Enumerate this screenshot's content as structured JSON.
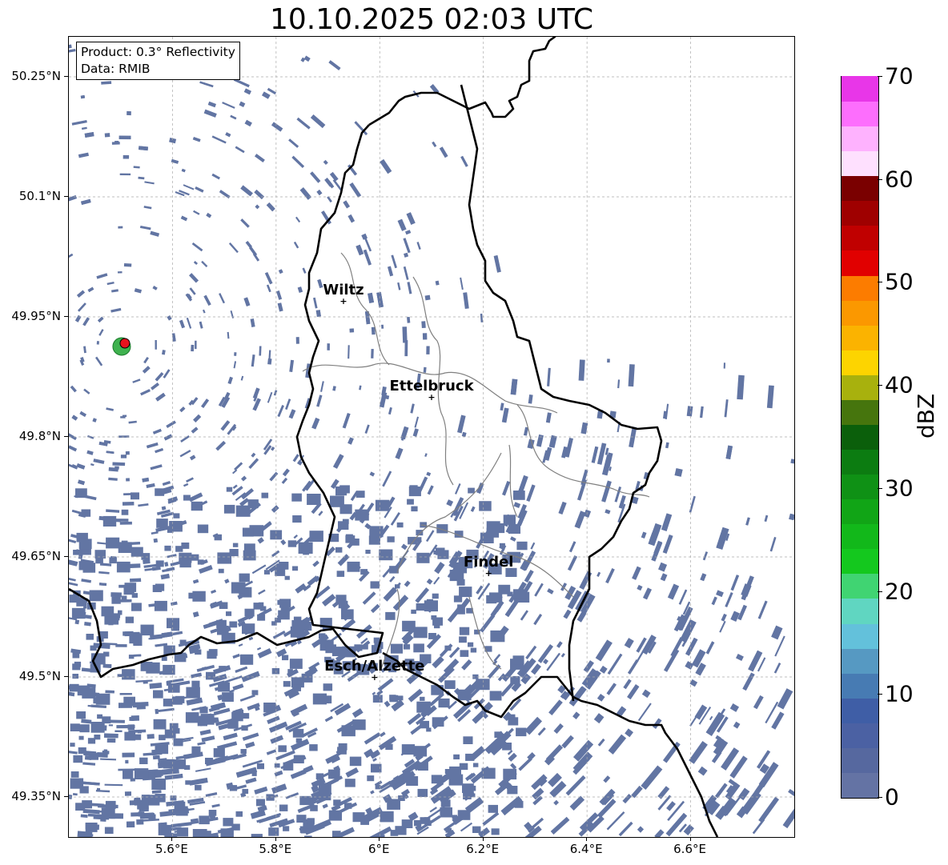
{
  "title": "10.10.2025 02:03 UTC",
  "info": {
    "product": "Product: 0.3° Reflectivity",
    "data_source": "Data: RMIB"
  },
  "axes": {
    "lat_labels": [
      "50.25°N",
      "50.1°N",
      "49.95°N",
      "49.8°N",
      "49.65°N",
      "49.5°N",
      "49.35°N"
    ],
    "lon_labels": [
      "5.6°E",
      "5.8°E",
      "6°E",
      "6.2°E",
      "6.4°E",
      "6.6°E"
    ],
    "lat_range": [
      49.3,
      50.3
    ],
    "lon_range": [
      5.4,
      6.8
    ],
    "grid": true
  },
  "cities": [
    {
      "name": "Wiltz",
      "lon": 5.93,
      "lat": 49.97
    },
    {
      "name": "Ettelbruck",
      "lon": 6.1,
      "lat": 49.85
    },
    {
      "name": "Findel",
      "lon": 6.21,
      "lat": 49.63
    },
    {
      "name": "Esch/Alzette",
      "lon": 5.99,
      "lat": 49.5
    }
  ],
  "radar_site": {
    "lon": 5.505,
    "lat": 49.915
  },
  "colorbar": {
    "label": "dBZ",
    "min": 0,
    "max": 70,
    "tick_labels": [
      "0",
      "10",
      "20",
      "30",
      "40",
      "50",
      "60",
      "70"
    ],
    "colors": [
      "#6473a4",
      "#56689f",
      "#4b61a3",
      "#3f5ea6",
      "#477bb3",
      "#5699c2",
      "#63c1db",
      "#60d6c1",
      "#40d472",
      "#14c81e",
      "#12b81a",
      "#11a516",
      "#0f9115",
      "#0c7c11",
      "#0b5f0b",
      "#46750d",
      "#a8b10d",
      "#fdd400",
      "#fbb300",
      "#fb9800",
      "#fc7c00",
      "#e10000",
      "#c00000",
      "#9f0000",
      "#7a0000",
      "#fee0fe",
      "#feb2fe",
      "#fd6efd",
      "#e836e8"
    ]
  },
  "echo_color": "#6275a3"
}
